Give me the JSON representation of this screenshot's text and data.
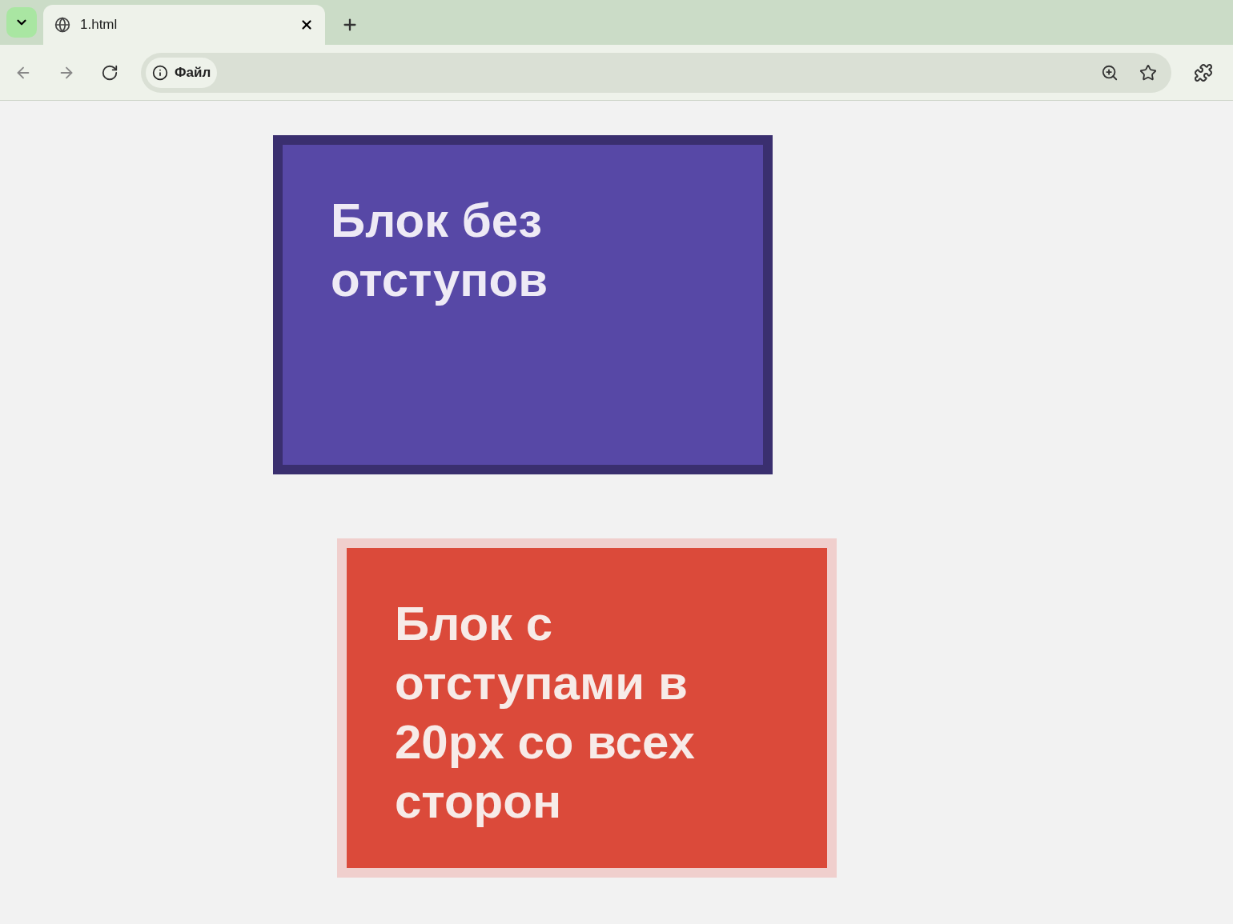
{
  "tabs": [
    {
      "title": "1.html",
      "selected": true
    }
  ],
  "address_bar": {
    "chip": "Файл"
  },
  "blocks": [
    {
      "kind": "plain",
      "color": "#5748a6",
      "text": "Блок без отступов"
    },
    {
      "kind": "margined",
      "color": "#db4a3a",
      "text": "Блок с отступами в 20px со всех сторон"
    }
  ]
}
